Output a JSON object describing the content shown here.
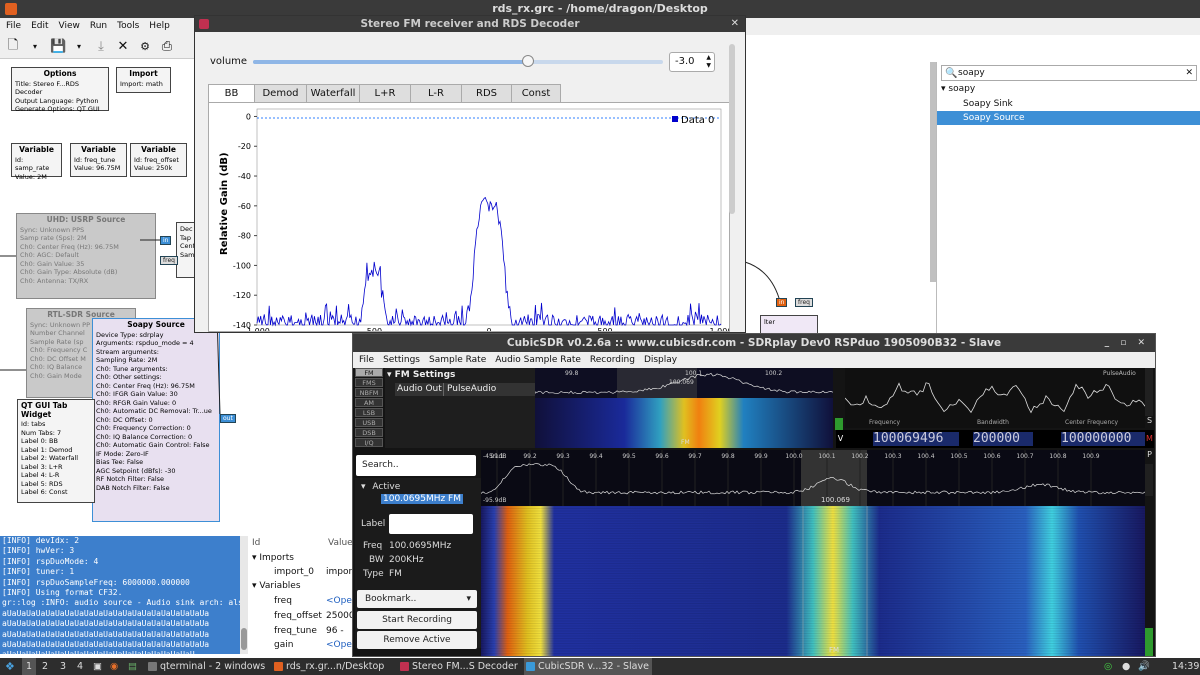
{
  "grc": {
    "title": "rds_rx.grc - /home/dragon/Desktop",
    "menu": [
      "File",
      "Edit",
      "View",
      "Run",
      "Tools",
      "Help"
    ],
    "blocks": {
      "options": {
        "title": "Options",
        "rows": [
          "Title: Stereo F...RDS Decoder",
          "Output Language: Python",
          "Generate Options: QT GUI"
        ]
      },
      "import": {
        "title": "Import",
        "rows": [
          "Import: math"
        ]
      },
      "var1": {
        "title": "Variable",
        "rows": [
          "Id: samp_rate",
          "Value: 2M"
        ]
      },
      "var2": {
        "title": "Variable",
        "rows": [
          "Id: freq_tune",
          "Value: 96.75M"
        ]
      },
      "var3": {
        "title": "Variable",
        "rows": [
          "Id: freq_offset",
          "Value: 250k"
        ]
      },
      "uhd": {
        "title": "UHD: USRP Source",
        "rows": [
          "Sync: Unknown PPS",
          "Samp rate (Sps): 2M",
          "Ch0: Center Freq (Hz): 96.75M",
          "Ch0: AGC: Default",
          "Ch0: Gain Value: 35",
          "Ch0: Gain Type: Absolute (dB)",
          "Ch0: Antenna: TX/RX"
        ]
      },
      "rtl": {
        "title": "RTL-SDR Source",
        "rows": [
          "Sync: Unknown PP",
          "Number Channel",
          "Sample Rate (sp",
          "Ch0: Frequency C",
          "Ch0: DC Offset M",
          "Ch0: IQ Balance",
          "Ch0: Gain Mode"
        ]
      },
      "soapy": {
        "title": "Soapy Source",
        "rows": [
          "Device Type: sdrplay",
          "Arguments: rspduo_mode = 4",
          "Stream arguments:",
          "Sampling Rate: 2M",
          "Ch0: Tune arguments:",
          "Ch0: Other settings:",
          "Ch0: Center Freq (Hz): 96.75M",
          "Ch0: IFGR Gain Value: 30",
          "Ch0: RFGR Gain Value: 0",
          "Ch0: Automatic DC Removal: Tr...ue",
          "Ch0: DC Offset: 0",
          "Ch0: Frequency Correction: 0",
          "Ch0: IQ Balance Correction: 0",
          "Ch0: Automatic Gain Control: False",
          "IF Mode: Zero-IF",
          "Bias Tee: False",
          "AGC Setpoint (dBfs): -30",
          "RF Notch Filter: False",
          "DAB Notch Filter: False"
        ]
      },
      "qttab": {
        "title": "QT GUI Tab Widget",
        "rows": [
          "Id: tabs",
          "Num Tabs: 7",
          "Label 0: BB",
          "Label 1: Demod",
          "Label 2: Waterfall",
          "Label 3: L+R",
          "Label 4: L-R",
          "Label 5: RDS",
          "Label 6: Const"
        ]
      },
      "filter_rows": [
        "Dec",
        "Tap",
        "Cent",
        "Sam"
      ]
    },
    "ports": {
      "in": "in",
      "freq": "freq",
      "out": "out"
    },
    "partial_block": "lter",
    "search": {
      "value": "soapy"
    },
    "tree": {
      "category": "soapy",
      "items": [
        "Soapy Sink",
        "Soapy Source"
      ]
    },
    "console": [
      "[INFO] devIdx: 2",
      "[INFO] hwVer: 3",
      "[INFO] rspDuoMode: 4",
      "[INFO] tuner: 1",
      "[INFO] rspDuoSampleFreq: 6000000.000000",
      "[INFO] Using format CF32.",
      "gr::log :INFO: audio source - Audio sink arch: alsa",
      "aUaUaUaUaUaUaUaUaUaUaUaUaUaUaUaUaUaUaUaUaUa",
      "aUaUaUaUaUaUaUaUaUaUaUaUaUaUaUaUaUaUaUaUaUa",
      "aUaUaUaUaUaUaUaUaUaUaUaUaUaUaUaUaUaUaUaUaUa",
      "aUaUaUaUaUaUaUaUaUaUaUaUaUaUaUaUaUaUaUaUaUa",
      "aUaUaUaUaUaUaUaUaUaUaUaUaUaUaUaUaUaUaUaU"
    ],
    "vars": {
      "col_id": "Id",
      "col_value": "Value",
      "imports": "Imports",
      "import0": "import_0",
      "import0_val": "import",
      "variables": "Variables",
      "v1": "freq",
      "v1_val": "<Oper",
      "v2": "freq_offset",
      "v2_val": "25000",
      "v3": "freq_tune",
      "v3_val": "96 -",
      "v4": "gain",
      "v4_val": "<Oper"
    }
  },
  "fm": {
    "title": "Stereo FM receiver and RDS Decoder",
    "volume_label": "volume",
    "volume": "-3.0",
    "volume_fraction": 0.67,
    "tabs": [
      "BB",
      "Demod",
      "Waterfall",
      "L+R",
      "L-R",
      "RDS",
      "Const"
    ],
    "active_tab": "BB"
  },
  "chart_data": {
    "type": "line",
    "ylabel": "Relative Gain (dB)",
    "yticks": [
      "0",
      "-20",
      "-40",
      "-60",
      "-80",
      "-100",
      "-120",
      "-140"
    ],
    "ylim": [
      -140,
      5
    ],
    "xlim": [
      -1000,
      1000
    ],
    "xticks": [
      "-1,000",
      "-500",
      "0",
      "500",
      "1,000"
    ],
    "legend": "Data 0",
    "legend_pos": "top-right",
    "series": [
      {
        "name": "Data 0",
        "color": "#0000cc"
      }
    ],
    "reference_level": -1,
    "peaks": [
      {
        "x": -500,
        "y": -97
      },
      {
        "x": 0,
        "y": -53
      },
      {
        "x": 900,
        "y": -130
      }
    ],
    "noise_floor": -133
  },
  "csd": {
    "title": "CubicSDR v0.2.6a :: www.cubicsdr.com - SDRplay Dev0 RSPduo 1905090B32 - Slave",
    "menu": [
      "File",
      "Settings",
      "Sample Rate",
      "Audio Sample Rate",
      "Recording",
      "Display"
    ],
    "modes": [
      "FM",
      "FMS",
      "NBFM",
      "AM",
      "LSB",
      "USB",
      "DSB",
      "I/Q"
    ],
    "fm_settings": "FM Settings",
    "audio_out_label": "Audio Out",
    "audio_out": "PulseAudio",
    "search": "Search..",
    "active": "Active",
    "active_item": "100.0695MHz FM",
    "label": "Label",
    "freq_label": "Freq",
    "freq": "100.0695MHz",
    "bw_label": "BW",
    "bw": "200KHz",
    "type_label": "Type",
    "type": "FM",
    "bookmark": "Bookmark..",
    "start_rec": "Start Recording",
    "remove": "Remove Active",
    "scope_labels": {
      "frequency": "Frequency",
      "bandwidth": "Bandwidth",
      "center": "Center Frequency",
      "pulse": "PulseAudio"
    },
    "freq_digits": "100069496",
    "bw_digits": "200000",
    "center_digits": "100000000",
    "v": "V",
    "m": "M",
    "s": "S",
    "p": "P",
    "spec_top_ticks": [
      "99.8",
      "100.1",
      "100.2"
    ],
    "spec_top_marker": "100.069",
    "spec_ticks": [
      "99.1",
      "99.2",
      "99.3",
      "99.4",
      "99.5",
      "99.6",
      "99.7",
      "99.8",
      "99.9",
      "100.0",
      "100.1",
      "100.2",
      "100.3",
      "100.4",
      "100.5",
      "100.6",
      "100.7",
      "100.8",
      "100.9"
    ],
    "spec_db_top": "-45.1dB",
    "spec_db_bot": "-95.9dB",
    "spec_marker": "100.069",
    "wf_label": "FM",
    "wf_label2": "FM",
    "wf_top_label": "FM"
  },
  "taskbar": {
    "workspaces": [
      "1",
      "2",
      "3",
      "4"
    ],
    "tasks": [
      "qterminal - 2 windows",
      "rds_rx.gr...n/Desktop",
      "Stereo FM...S Decoder",
      "CubicSDR v...32 - Slave"
    ],
    "time": "14:39"
  }
}
